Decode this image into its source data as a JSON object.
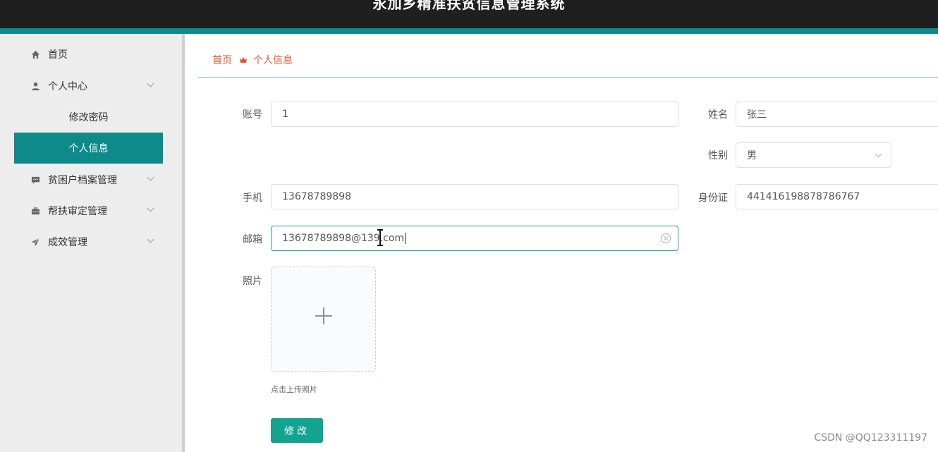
{
  "header": {
    "title": "永加乡精准扶贫信息管理系统"
  },
  "sidebar": {
    "items": [
      {
        "label": "首页",
        "icon": "home-icon"
      },
      {
        "label": "个人中心",
        "icon": "user-icon",
        "expanded": true,
        "children": [
          {
            "label": "修改密码"
          },
          {
            "label": "个人信息",
            "active": true
          }
        ]
      },
      {
        "label": "贫困户档案管理",
        "icon": "comment-icon"
      },
      {
        "label": "帮扶审定管理",
        "icon": "briefcase-icon"
      },
      {
        "label": "成效管理",
        "icon": "send-icon"
      }
    ]
  },
  "breadcrumb": {
    "home": "首页",
    "current": "个人信息"
  },
  "form": {
    "account": {
      "label": "账号",
      "value": "1"
    },
    "name": {
      "label": "姓名",
      "value": "张三"
    },
    "gender": {
      "label": "性别",
      "value": "男"
    },
    "phone": {
      "label": "手机",
      "value": "13678789898"
    },
    "idcard": {
      "label": "身份证",
      "value": "441416198878786767"
    },
    "email": {
      "label": "邮箱",
      "value": "13678789898@139.com"
    },
    "photo": {
      "label": "照片",
      "tip": "点击上传照片"
    },
    "submit_label": "修改"
  },
  "colors": {
    "accent": "#0e8a8a",
    "button": "#12a48f",
    "breadcrumb": "#e8542d"
  },
  "watermark": "CSDN @QQ123311197"
}
